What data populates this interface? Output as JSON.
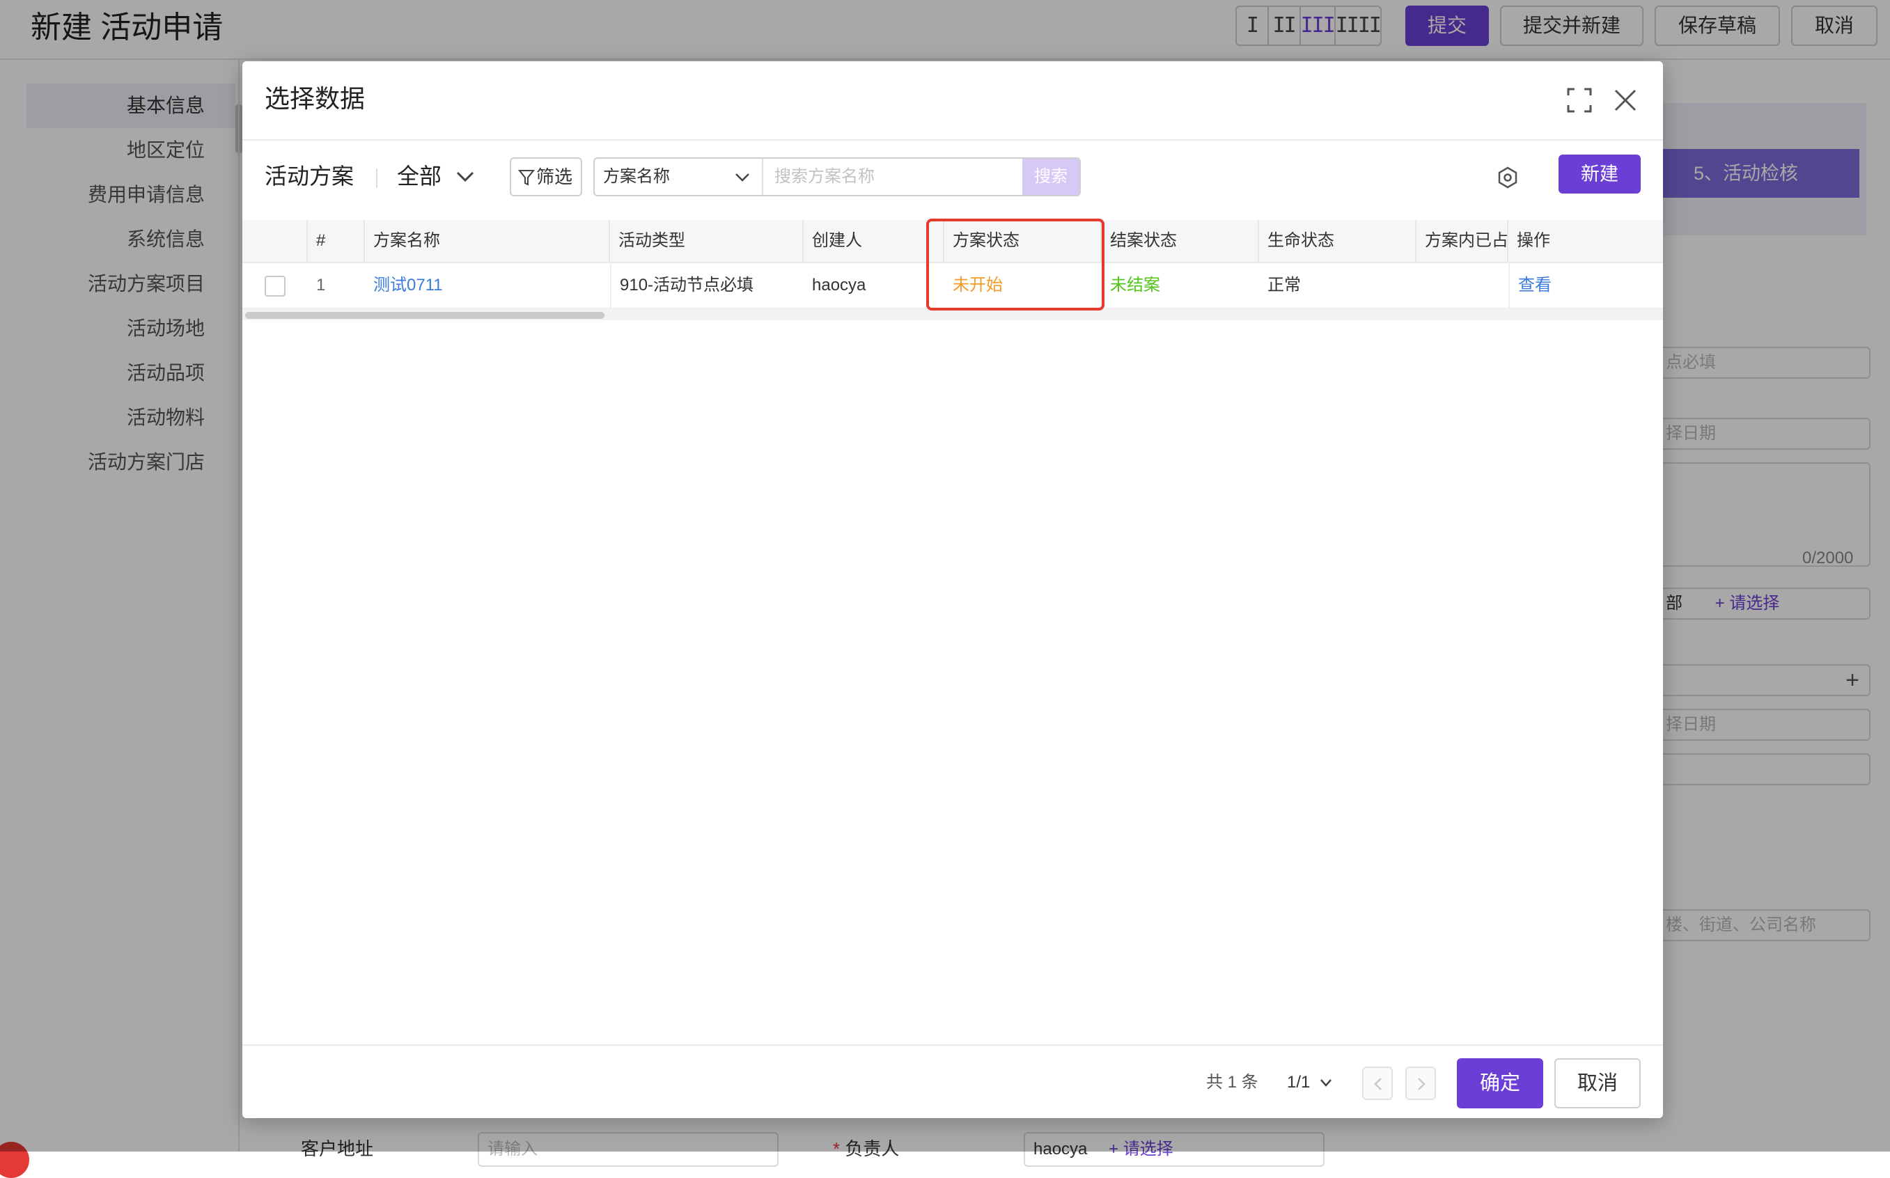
{
  "page": {
    "title": "新建 活动申请",
    "layout_options": [
      "I",
      "II",
      "III",
      "IIII"
    ],
    "layout_active_index": 2,
    "buttons": {
      "submit": "提交",
      "submit_new": "提交并新建",
      "save_draft": "保存草稿",
      "cancel": "取消"
    }
  },
  "sidebar": {
    "items": [
      {
        "label": "基本信息",
        "active": true
      },
      {
        "label": "地区定位"
      },
      {
        "label": "费用申请信息"
      },
      {
        "label": "系统信息"
      },
      {
        "label": "活动方案项目"
      },
      {
        "label": "活动场地"
      },
      {
        "label": "活动品项"
      },
      {
        "label": "活动物料"
      },
      {
        "label": "活动方案门店"
      }
    ]
  },
  "background_form": {
    "step_label": "5、活动检核",
    "field_select_partial": "点必填",
    "date_placeholder_partial": "择日期",
    "textarea_counter": "0/2000",
    "tag_partial": "部",
    "tag_add": "+ 请选择",
    "date2_placeholder_partial": "择日期",
    "address_placeholder_partial": "楼、街道、公司名称",
    "customer_address_label": "客户地址",
    "customer_address_placeholder": "请输入",
    "owner_label": "负责人",
    "owner_required_mark": "*",
    "owner_tag": "haocya",
    "owner_add": "+ 请选择"
  },
  "modal": {
    "title": "选择数据",
    "toolbar": {
      "object_name": "活动方案",
      "view_name": "全部",
      "filter_label": "筛选",
      "search_field": "方案名称",
      "search_placeholder": "搜索方案名称",
      "search_button": "搜索",
      "new_button": "新建"
    },
    "table": {
      "headers": {
        "index": "#",
        "name": "方案名称",
        "type": "活动类型",
        "creator": "创建人",
        "plan_status": "方案状态",
        "close_status": "结案状态",
        "life_status": "生命状态",
        "occupied": "方案内已占",
        "action": "操作"
      },
      "rows": [
        {
          "index": "1",
          "name": "测试0711",
          "type": "910-活动节点必填",
          "creator": "haocya",
          "plan_status": "未开始",
          "close_status": "未结案",
          "life_status": "正常",
          "occupied": "",
          "action": "查看"
        }
      ]
    },
    "footer": {
      "total": "共 1 条",
      "page": "1/1",
      "confirm": "确定",
      "cancel": "取消"
    },
    "colors": {
      "accent": "#6b3fd6",
      "link": "#3a7bdc",
      "pending": "#f59a23",
      "open": "#52c41a",
      "highlight": "#e53b2c"
    }
  }
}
